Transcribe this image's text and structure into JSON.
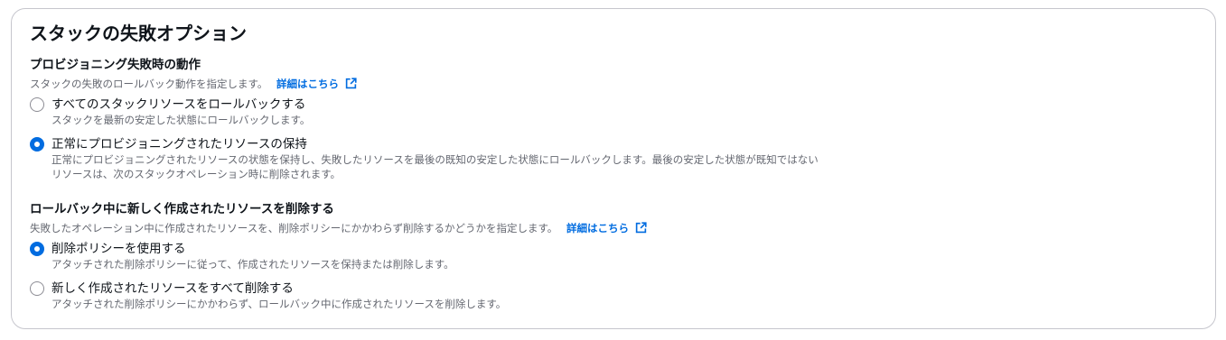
{
  "panel": {
    "title": "スタックの失敗オプション"
  },
  "provisioning": {
    "heading": "プロビジョニング失敗時の動作",
    "description": "スタックの失敗のロールバック動作を指定します。",
    "info_link": "詳細はこちら",
    "options": [
      {
        "label": "すべてのスタックリソースをロールバックする",
        "description": "スタックを最新の安定した状態にロールバックします。",
        "checked": false
      },
      {
        "label": "正常にプロビジョニングされたリソースの保持",
        "description": "正常にプロビジョニングされたリソースの状態を保持し、失敗したリソースを最後の既知の安定した状態にロールバックします。最後の安定した状態が既知ではないリソースは、次のスタックオペレーション時に削除されます。",
        "checked": true
      }
    ]
  },
  "rollback_delete": {
    "heading": "ロールバック中に新しく作成されたリソースを削除する",
    "description": "失敗したオペレーション中に作成されたリソースを、削除ポリシーにかかわらず削除するかどうかを指定します。",
    "info_link": "詳細はこちら",
    "options": [
      {
        "label": "削除ポリシーを使用する",
        "description": "アタッチされた削除ポリシーに従って、作成されたリソースを保持または削除します。",
        "checked": true
      },
      {
        "label": "新しく作成されたリソースをすべて削除する",
        "description": "アタッチされた削除ポリシーにかかわらず、ロールバック中に作成されたリソースを削除します。",
        "checked": false
      }
    ]
  },
  "icons": {
    "external_link": "external-link-icon"
  },
  "colors": {
    "accent": "#006ce0",
    "text": "#0f141a",
    "secondary_text": "#656871",
    "border": "#c6c6cd"
  }
}
